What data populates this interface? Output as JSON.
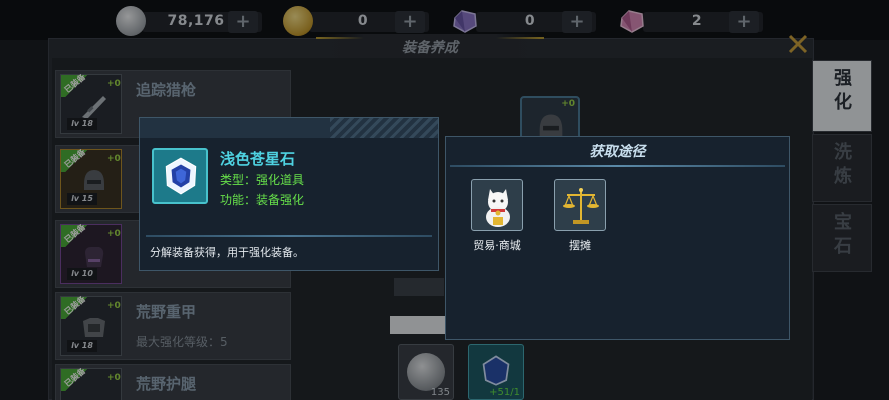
{
  "currencies": [
    {
      "icon": "silver-coin-icon",
      "amount": "78,176",
      "plus": "+"
    },
    {
      "icon": "gold-coin-icon",
      "amount": "0",
      "plus": "+"
    },
    {
      "icon": "purple-gem-icon",
      "amount": "0",
      "plus": "+"
    },
    {
      "icon": "pink-gem-icon",
      "amount": "2",
      "plus": "+"
    }
  ],
  "window": {
    "title": "装备养成"
  },
  "equipment": [
    {
      "badge": "已装备",
      "plus": "+0",
      "level": "lv 18",
      "name": "追踪猎枪",
      "sub": ""
    },
    {
      "badge": "已装备",
      "plus": "+0",
      "level": "lv 15",
      "name": "",
      "sub": ""
    },
    {
      "badge": "已装备",
      "plus": "+0",
      "level": "lv 10",
      "name": "",
      "sub": ""
    },
    {
      "badge": "已装备",
      "plus": "+0",
      "level": "lv 18",
      "name": "荒野重甲",
      "sub": "最大强化等级：5"
    },
    {
      "badge": "已装备",
      "plus": "+0",
      "level": "",
      "name": "荒野护腿",
      "sub": ""
    }
  ],
  "side_tabs": [
    {
      "label": "强化",
      "active": true
    },
    {
      "label": "洗炼",
      "active": false
    },
    {
      "label": "宝石",
      "active": false
    }
  ],
  "center": {
    "slot_plus": "+0"
  },
  "bottom_items": [
    {
      "count": "135"
    },
    {
      "count": "+51/1"
    }
  ],
  "tooltip": {
    "name": "浅色苍星石",
    "type_line": "类型：强化道具",
    "func_line": "功能：装备强化",
    "desc": "分解装备获得，用于强化装备。"
  },
  "acquire": {
    "title": "获取途径",
    "sources": [
      {
        "icon": "lucky-cat-icon",
        "label": "贸易·商城"
      },
      {
        "icon": "balance-scale-icon",
        "label": "摆摊"
      }
    ]
  },
  "colors": {
    "accent_gold": "#b79a34",
    "tooltip_name": "#4fd3e2",
    "tooltip_green": "#67e04a"
  }
}
